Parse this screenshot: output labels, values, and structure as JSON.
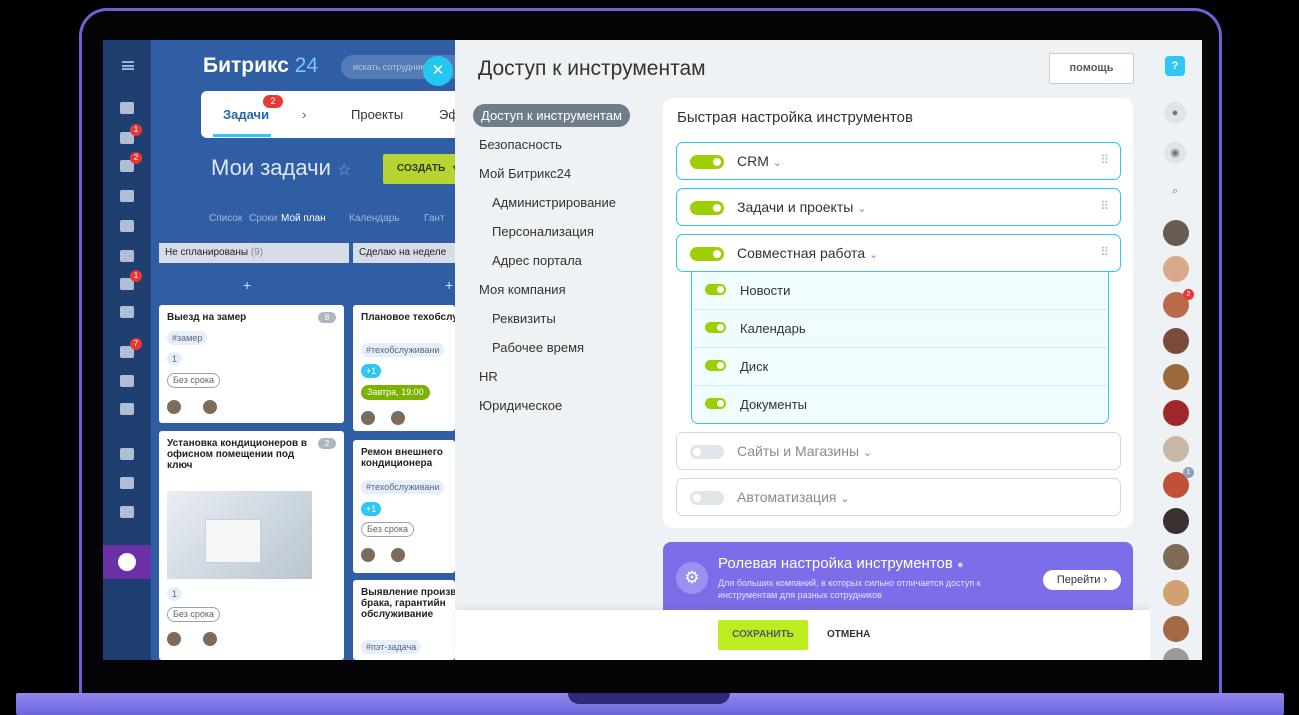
{
  "portal": {
    "brand": "Битрикс",
    "brand_num": "24",
    "search_placeholder": "искать сотрудника, док"
  },
  "tasks": {
    "tabs": [
      {
        "label": "Задачи",
        "badge": "2"
      },
      {
        "label": "Проекты"
      },
      {
        "label": "Эффектив"
      }
    ],
    "page_title": "Мои задачи",
    "create_label": "СОЗДАТЬ",
    "views": [
      "Список",
      "Сроки",
      "Мой план",
      "Календарь",
      "Гант"
    ],
    "columns": [
      {
        "title": "Не спланированы",
        "count": "(9)"
      },
      {
        "title": "Сделаю на неделе"
      }
    ],
    "cards": [
      {
        "title": "Выезд на замер",
        "count": "8",
        "tag": "#замер",
        "files": "1",
        "deadline": "Без срока"
      },
      {
        "title": "Плановое техобслуживание",
        "tag": "#техобслуживани",
        "files": "+1",
        "deadline": "Завтра, 19:00"
      },
      {
        "title": "Установка кондиционеров в офисном помещении под ключ",
        "count": "2",
        "files": "1",
        "deadline": "Без срока"
      },
      {
        "title": "Ремон внешнего кондиционера",
        "tag": "#техобслуживани",
        "files": "+1",
        "deadline": "Без срока"
      },
      {
        "title": "Выявление производственно брака, гарантийн обслуживание",
        "tag": "#пэт-задача"
      }
    ]
  },
  "left_nav_badges": [
    "1",
    "2",
    "1",
    "7"
  ],
  "slider": {
    "title": "Доступ к инструментам",
    "help_label": "помощь",
    "menu": [
      {
        "label": "Доступ к инструментам",
        "active": true
      },
      {
        "label": "Безопасность"
      },
      {
        "label": "Мой Битрикс24"
      },
      {
        "label": "Администрирование"
      },
      {
        "label": "Персонализация"
      },
      {
        "label": "Адрес портала"
      },
      {
        "label": "Моя компания"
      },
      {
        "label": "Реквизиты"
      },
      {
        "label": "Рабочее время"
      },
      {
        "label": "HR"
      },
      {
        "label": "Юридическое"
      }
    ],
    "quick": {
      "title": "Быстрая настройка инструментов",
      "tools": [
        {
          "label": "CRM",
          "enabled": true
        },
        {
          "label": "Задачи и проекты",
          "enabled": true
        },
        {
          "label": "Совместная работа",
          "enabled": true
        },
        {
          "label": "Сайты и Магазины",
          "enabled": false
        },
        {
          "label": "Автоматизация",
          "enabled": false
        }
      ],
      "sub_tools": [
        {
          "label": "Новости",
          "enabled": true
        },
        {
          "label": "Календарь",
          "enabled": true
        },
        {
          "label": "Диск",
          "enabled": true
        },
        {
          "label": "Документы",
          "enabled": true
        }
      ]
    },
    "role": {
      "title": "Ролевая настройка инструментов",
      "desc": "Для больших компаний, в которых сильно отличается доступ к инструментам для разных сотрудников",
      "go_label": "Перейти"
    },
    "save_label": "СОХРАНИТЬ",
    "cancel_label": "ОТМЕНА"
  },
  "rightbar": {
    "help_icon_text": "?",
    "avatar_badges": [
      "2",
      "1"
    ]
  },
  "colors": {
    "accent_cyan": "#2fc6f6",
    "toggle_green": "#9dcf00",
    "save_green": "#bbed21",
    "role_purple": "#7b6ee8",
    "frame_purple": "#6a63d6"
  }
}
